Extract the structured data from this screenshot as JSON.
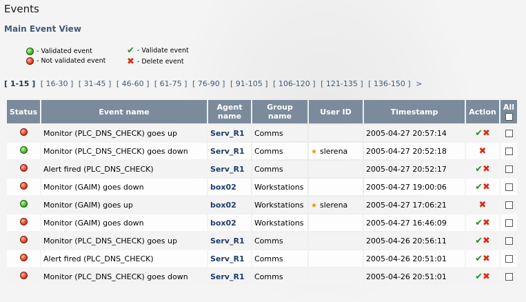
{
  "page": {
    "title": "Events",
    "subtitle": "Main Event View"
  },
  "legend": {
    "validated": "- Validated event",
    "not_validated": "- Not validated event",
    "validate": "- Validate event",
    "delete": "- Delete event"
  },
  "pager": {
    "current": "[ 1-15 ]",
    "pages": [
      "[ 16-30 ]",
      "[ 31-45 ]",
      "[ 46-60 ]",
      "[ 61-75 ]",
      "[ 76-90 ]",
      "[ 91-105 ]",
      "[ 106-120 ]",
      "[ 121-135 ]",
      "[ 136-150 ]"
    ],
    "next": ">"
  },
  "table": {
    "headers": {
      "status": "Status",
      "event": "Event name",
      "agent": "Agent name",
      "group": "Group name",
      "user": "User ID",
      "ts": "Timestamp",
      "action": "Action",
      "all": "All"
    },
    "rows": [
      {
        "validated": false,
        "event": "Monitor (PLC_DNS_CHECK) goes up",
        "agent": "Serv_R1",
        "group": "Comms",
        "user": "",
        "ts": "2005-04-27 20:57:14"
      },
      {
        "validated": true,
        "event": "Monitor (PLC_DNS_CHECK) goes down",
        "agent": "Serv_R1",
        "group": "Comms",
        "user": "slerena",
        "ts": "2005-04-27 20:52:18"
      },
      {
        "validated": false,
        "event": "Alert fired (PLC_DNS_CHECK)",
        "agent": "Serv_R1",
        "group": "Comms",
        "user": "",
        "ts": "2005-04-27 20:52:17"
      },
      {
        "validated": false,
        "event": "Monitor (GAIM) goes down",
        "agent": "box02",
        "group": "Workstations",
        "user": "",
        "ts": "2005-04-27 19:00:06"
      },
      {
        "validated": true,
        "event": "Monitor (GAIM) goes up",
        "agent": "box02",
        "group": "Workstations",
        "user": "slerena",
        "ts": "2005-04-27 17:06:21"
      },
      {
        "validated": false,
        "event": "Monitor (GAIM) goes down",
        "agent": "box02",
        "group": "Workstations",
        "user": "",
        "ts": "2005-04-27 16:46:09"
      },
      {
        "validated": false,
        "event": "Monitor (PLC_DNS_CHECK) goes up",
        "agent": "Serv_R1",
        "group": "Comms",
        "user": "",
        "ts": "2005-04-26 20:56:11"
      },
      {
        "validated": false,
        "event": "Alert fired (PLC_DNS_CHECK)",
        "agent": "Serv_R1",
        "group": "Comms",
        "user": "",
        "ts": "2005-04-26 20:51:01"
      },
      {
        "validated": false,
        "event": "Monitor (PLC_DNS_CHECK) goes down",
        "agent": "Serv_R1",
        "group": "Comms",
        "user": "",
        "ts": "2005-04-26 20:51:01"
      }
    ]
  },
  "icons": {
    "green": "#3cba1f",
    "red": "#e0401f",
    "check": "#2e8b2e",
    "cross": "#e02a10"
  }
}
